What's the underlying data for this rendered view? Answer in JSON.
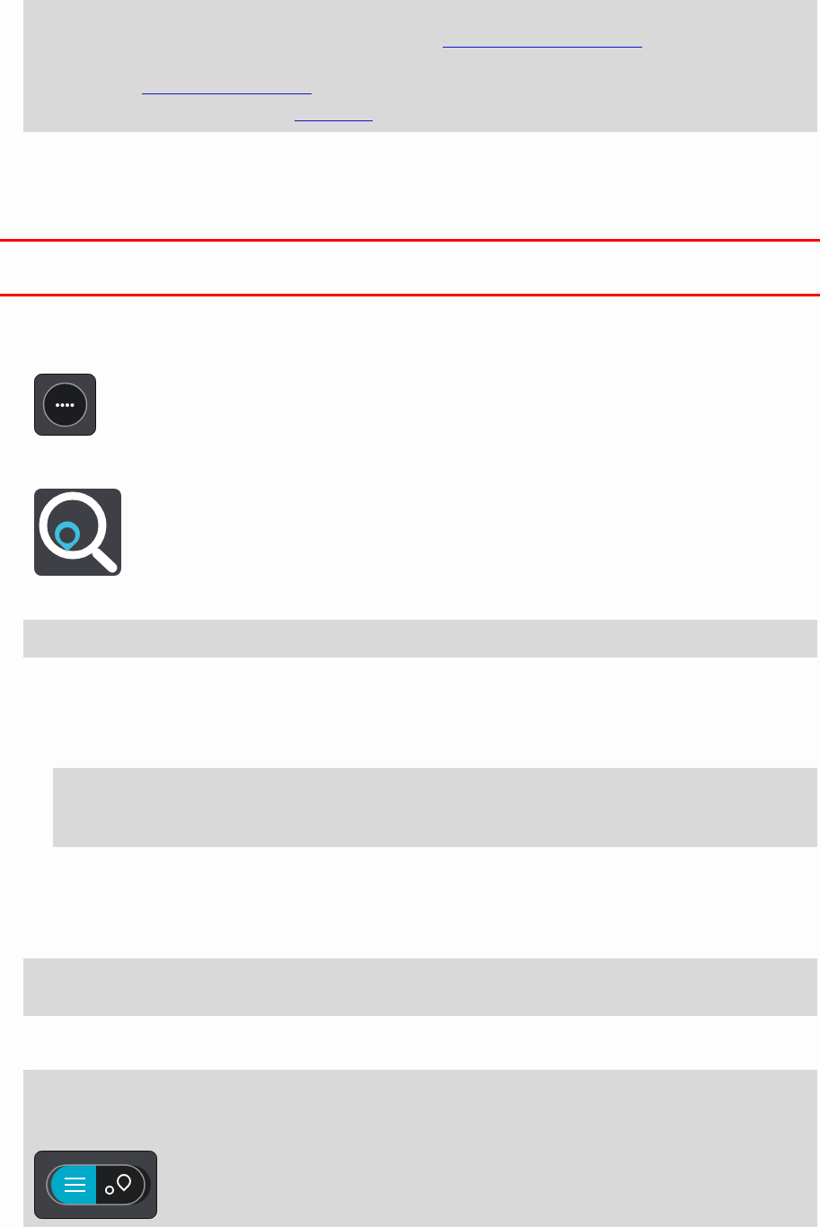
{
  "blocks": [
    {
      "kind": "note",
      "links": [
        {
          "kind": "link"
        },
        {
          "kind": "link"
        },
        {
          "kind": "link"
        }
      ]
    },
    {
      "kind": "rule"
    },
    {
      "kind": "rule"
    },
    {
      "kind": "more_icon"
    },
    {
      "kind": "search_icon"
    },
    {
      "kind": "bar"
    },
    {
      "kind": "indented_note"
    },
    {
      "kind": "bar"
    },
    {
      "kind": "switch_note"
    }
  ]
}
